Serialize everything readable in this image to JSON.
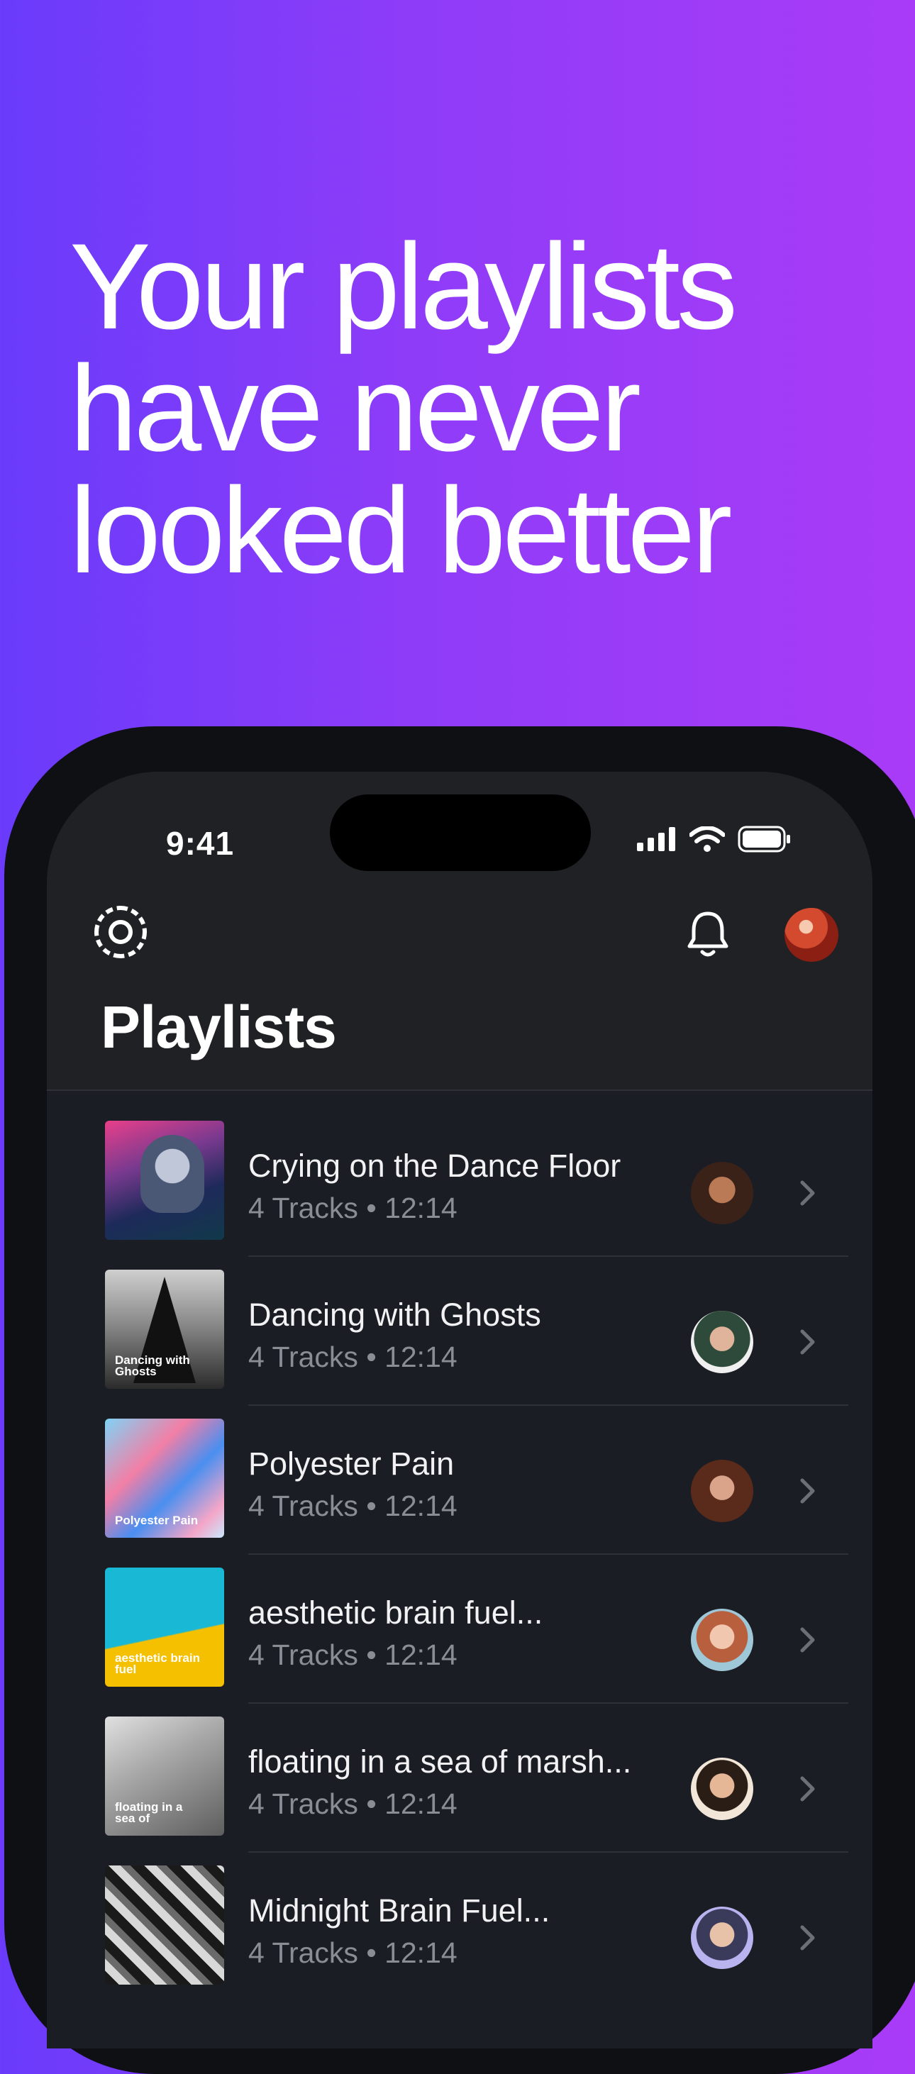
{
  "headline": "Your playlists\nhave never\nlooked better",
  "status_bar": {
    "time": "9:41"
  },
  "app": {
    "logo_icon": "camera-aperture-icon",
    "notifications_icon": "bell-icon",
    "page_title": "Playlists"
  },
  "playlists": [
    {
      "title": "Crying on the Dance Floor",
      "meta": "4 Tracks • 12:14",
      "cover_text": ""
    },
    {
      "title": "Dancing with Ghosts",
      "meta": "4 Tracks • 12:14",
      "cover_text": "Dancing with Ghosts"
    },
    {
      "title": "Polyester Pain",
      "meta": "4 Tracks • 12:14",
      "cover_text": "Polyester Pain"
    },
    {
      "title": "aesthetic brain fuel...",
      "meta": "4 Tracks • 12:14",
      "cover_text": "aesthetic brain fuel"
    },
    {
      "title": "floating in a sea of marsh...",
      "meta": "4 Tracks • 12:14",
      "cover_text": "floating in a sea of"
    },
    {
      "title": "Midnight Brain Fuel...",
      "meta": "4 Tracks • 12:14",
      "cover_text": ""
    }
  ],
  "colors": {
    "gradient_start": "#6a3bfb",
    "gradient_end": "#a93bf7",
    "screen_bg": "#1b1d24"
  }
}
